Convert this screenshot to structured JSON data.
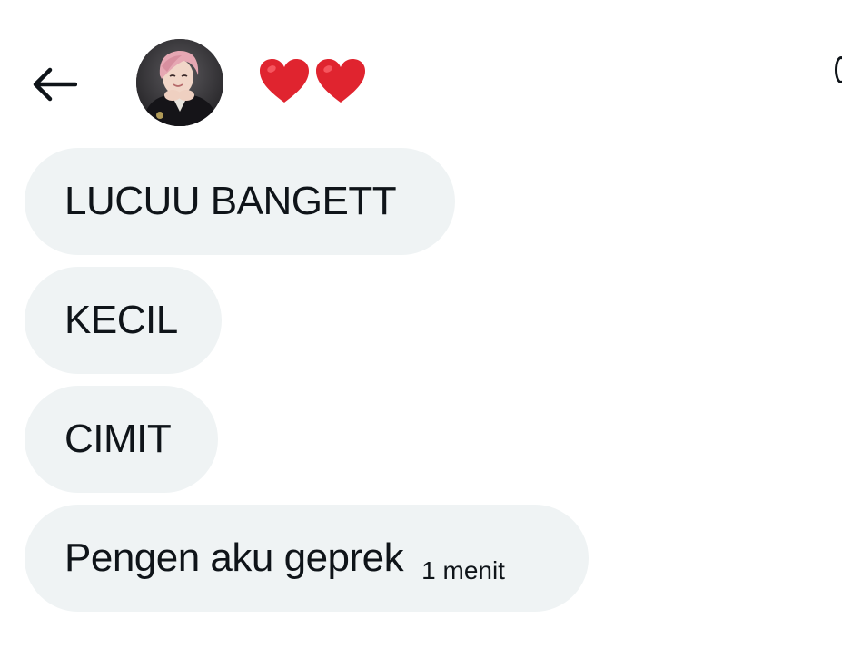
{
  "header": {
    "title_emoji": [
      "heart",
      "heart"
    ],
    "back_icon": "arrow-left-icon",
    "avatar_alt": "avatar",
    "edge_icon": "info-icon"
  },
  "messages": [
    {
      "text": "LUCUU BANGETT"
    },
    {
      "text": "KECIL"
    },
    {
      "text": "CIMIT"
    },
    {
      "text": "Pengen aku geprek",
      "time": "1 menit"
    }
  ],
  "colors": {
    "bubble_bg": "#eff3f4",
    "text": "#0f1419",
    "heart": "#e0242f",
    "background": "#ffffff"
  }
}
